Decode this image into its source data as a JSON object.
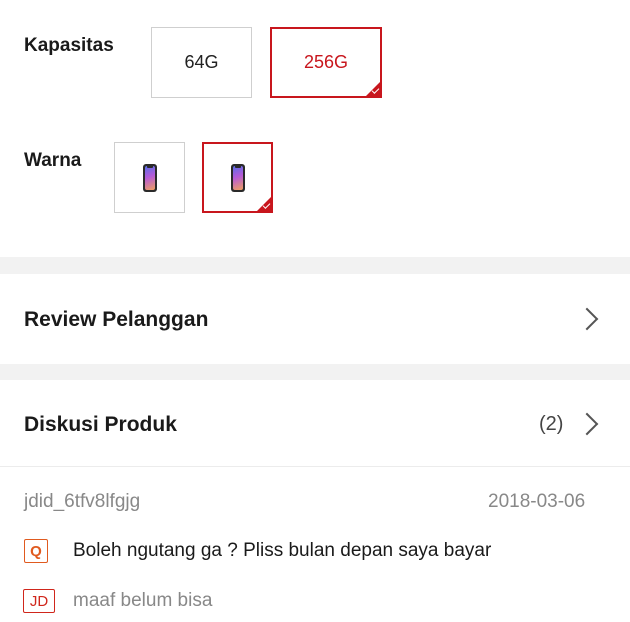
{
  "capacity": {
    "label": "Kapasitas",
    "options": [
      {
        "label": "64G",
        "selected": false
      },
      {
        "label": "256G",
        "selected": true
      }
    ]
  },
  "color": {
    "label": "Warna",
    "options": [
      {
        "icon": "phone-thumbnail-icon",
        "selected": false
      },
      {
        "icon": "phone-thumbnail-icon",
        "selected": true
      }
    ]
  },
  "review": {
    "title": "Review Pelanggan",
    "icon": "chevron-right-icon"
  },
  "discussion": {
    "title": "Diskusi Produk",
    "count": "(2)",
    "icon": "chevron-right-icon",
    "item": {
      "user": "jdid_6tfv8lfgjg",
      "date": "2018-03-06",
      "question_badge": "Q",
      "question": "Boleh ngutang ga ? Pliss bulan depan saya bayar",
      "answer_badge": "JD",
      "answer": "maaf belum bisa"
    }
  },
  "colors": {
    "accent": "#c8161d",
    "question_badge": "#e05a1f",
    "divider": "#f2f2f2"
  }
}
